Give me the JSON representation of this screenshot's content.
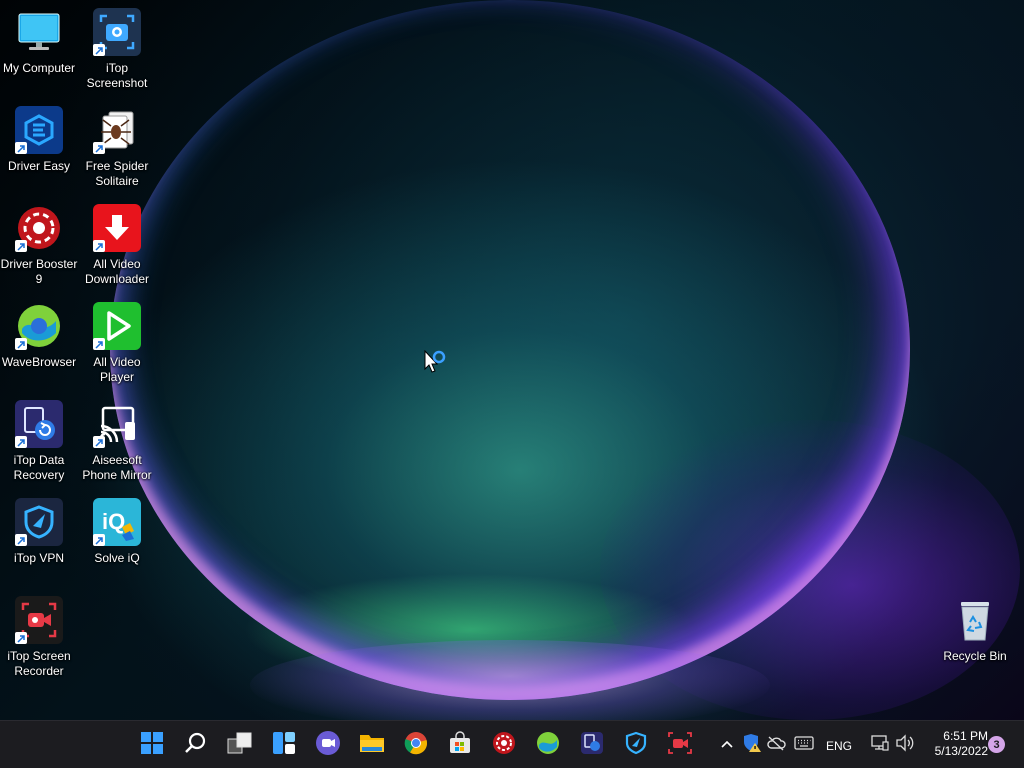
{
  "desktop": {
    "icons": [
      {
        "label": "My Computer",
        "icon": "monitor-icon"
      },
      {
        "label": "iTop Screenshot",
        "icon": "itop-screenshot-icon"
      },
      {
        "label": "Driver Easy",
        "icon": "driver-easy-icon"
      },
      {
        "label": "Free Spider Solitaire",
        "icon": "spider-solitaire-icon"
      },
      {
        "label": "Driver Booster 9",
        "icon": "driver-booster-icon"
      },
      {
        "label": "All Video Downloader",
        "icon": "download-arrow-icon"
      },
      {
        "label": "WaveBrowser",
        "icon": "wavebrowser-icon"
      },
      {
        "label": "All Video Player",
        "icon": "play-icon"
      },
      {
        "label": "iTop Data Recovery",
        "icon": "data-recovery-icon"
      },
      {
        "label": "Aiseesoft Phone Mirror",
        "icon": "phone-mirror-icon"
      },
      {
        "label": "iTop VPN",
        "icon": "vpn-shield-icon"
      },
      {
        "label": "Solve iQ",
        "icon": "solve-iq-icon"
      },
      {
        "label": "iTop Screen Recorder",
        "icon": "screen-recorder-icon"
      },
      {
        "label": "Recycle Bin",
        "icon": "recycle-bin-icon"
      }
    ]
  },
  "taskbar": {
    "apps": [
      {
        "name": "start-button",
        "icon": "windows-logo-icon"
      },
      {
        "name": "search-button",
        "icon": "search-icon"
      },
      {
        "name": "task-view-button",
        "icon": "task-view-icon"
      },
      {
        "name": "widgets-button",
        "icon": "widgets-icon"
      },
      {
        "name": "chat-button",
        "icon": "teams-chat-icon"
      },
      {
        "name": "file-explorer-button",
        "icon": "folder-icon"
      },
      {
        "name": "chrome-button",
        "icon": "chrome-icon"
      },
      {
        "name": "microsoft-store-button",
        "icon": "store-bag-icon"
      },
      {
        "name": "driver-booster-taskbar-button",
        "icon": "driver-booster-icon"
      },
      {
        "name": "wavebrowser-taskbar-button",
        "icon": "wavebrowser-icon"
      },
      {
        "name": "data-recovery-taskbar-button",
        "icon": "data-recovery-icon"
      },
      {
        "name": "vpn-taskbar-button",
        "icon": "vpn-shield-icon"
      },
      {
        "name": "screen-recorder-taskbar-button",
        "icon": "screen-recorder-icon"
      }
    ],
    "tray": {
      "language": "ENG",
      "time": "6:51 PM",
      "date": "5/13/2022",
      "notification_count": "3"
    }
  },
  "colors": {
    "taskbar_bg": "#1c1c20",
    "accent": "#0078d4",
    "badge": "#d4a5e8"
  }
}
